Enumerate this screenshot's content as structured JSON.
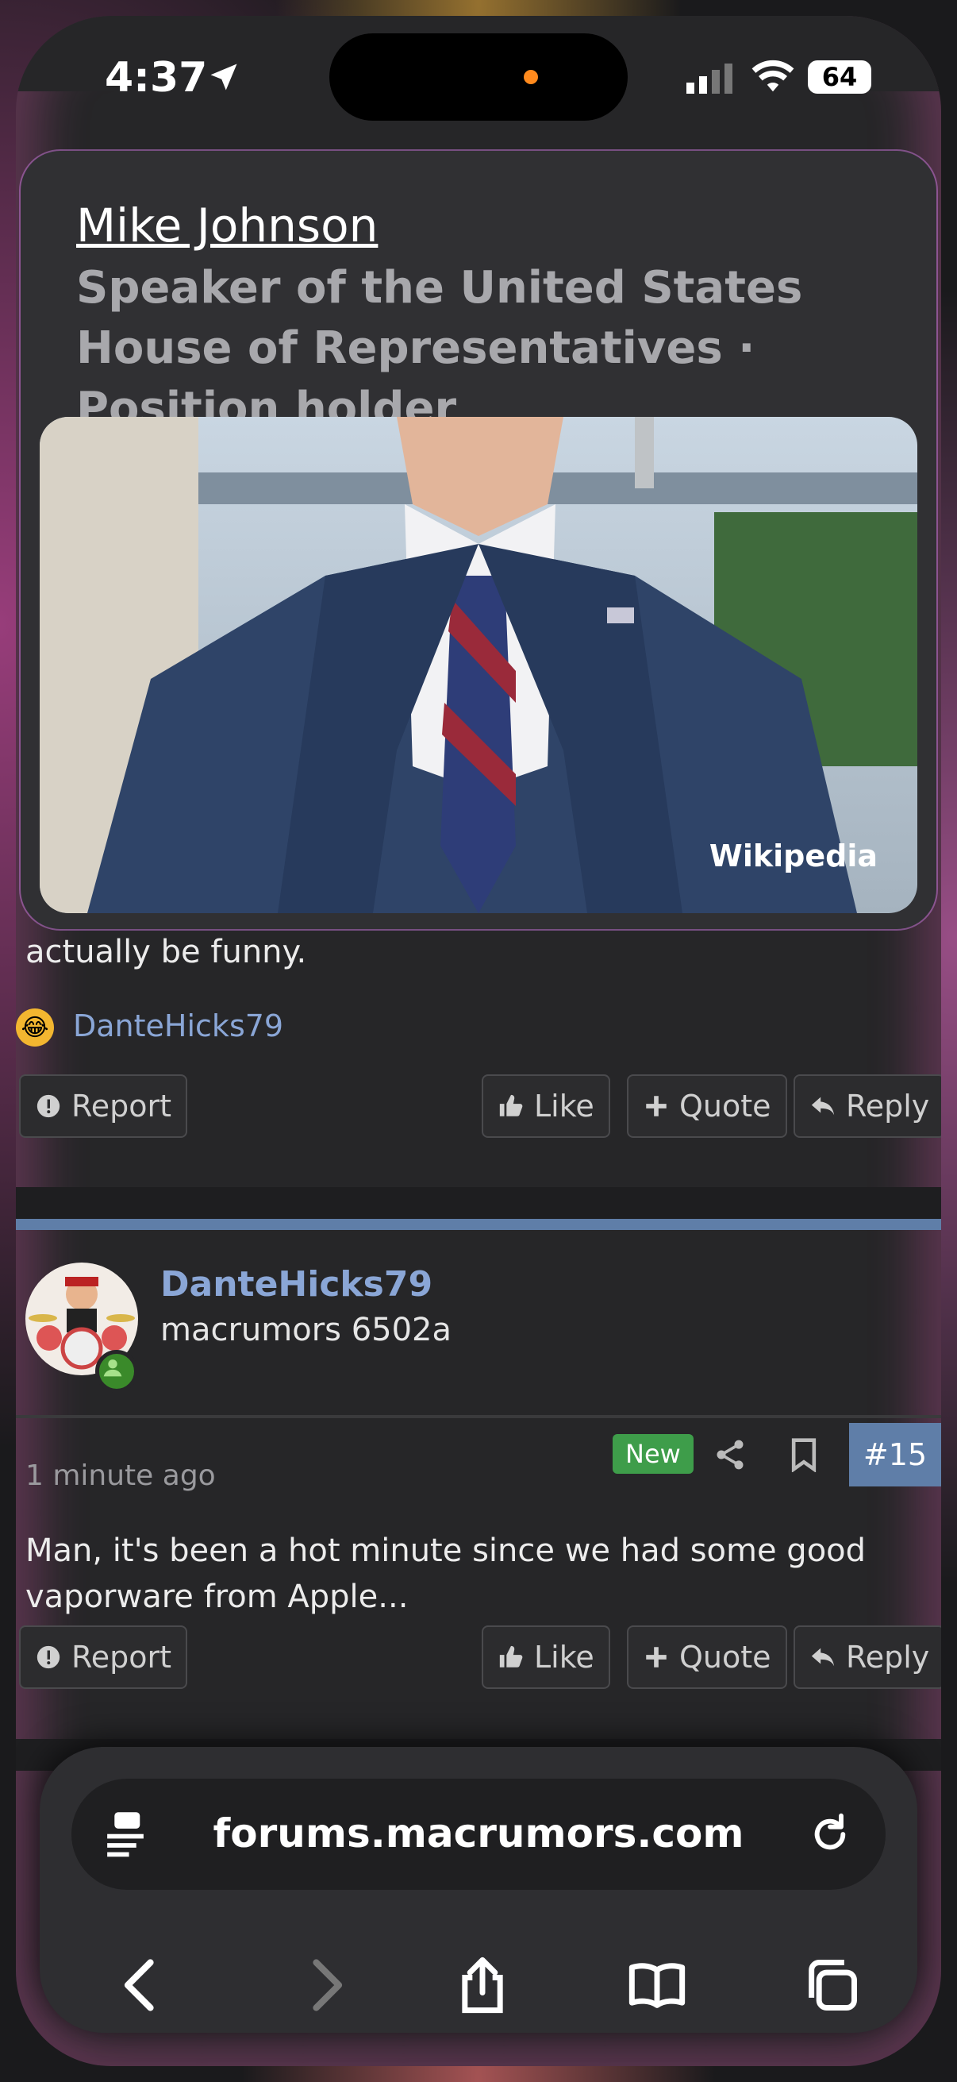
{
  "status_bar": {
    "time": "4:37",
    "battery": "64"
  },
  "card": {
    "title": "Mike Johnson",
    "subtitle": "Speaker of the United States House of Representatives · Position holder",
    "image_source": "Wikipedia"
  },
  "post1": {
    "text": "actually be funny.",
    "reaction_user": "DanteHicks79"
  },
  "actions": {
    "report": "Report",
    "like": "Like",
    "quote": "Quote",
    "reply": "Reply"
  },
  "post2": {
    "username": "DanteHicks79",
    "user_title": "macrumors 6502a",
    "time_ago": "1 minute ago",
    "badge": "New",
    "post_number": "#15",
    "text": "Man, it's been a hot minute since we had some good vaporware from Apple..."
  },
  "browser": {
    "url": "forums.macrumors.com"
  },
  "colors": {
    "accent": "#5f7ea8",
    "username": "#8aa6d6",
    "new_badge": "#3e9d4a"
  }
}
